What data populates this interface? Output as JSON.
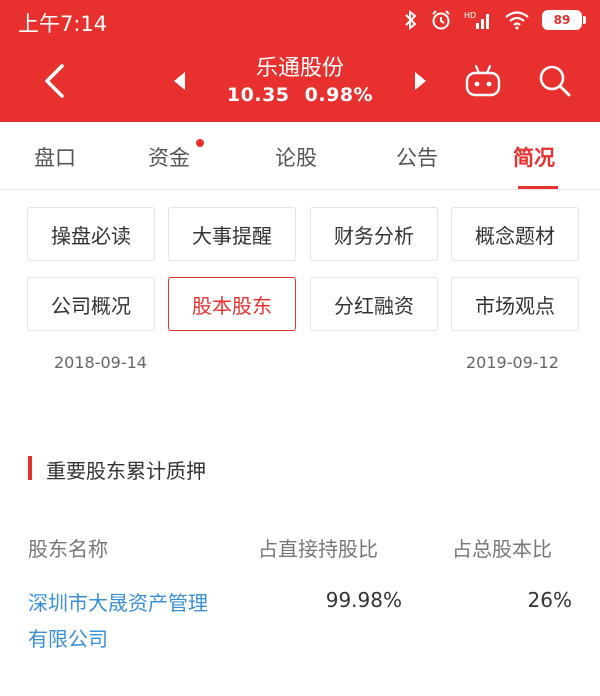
{
  "status_bar": {
    "time": "上午7:14",
    "battery": "89"
  },
  "header": {
    "stock_name": "乐通股份",
    "price": "10.35",
    "change_pct": "0.98%",
    "background_color": "#e8312f"
  },
  "tabs": [
    {
      "label": "盘口",
      "active": false,
      "dot": false
    },
    {
      "label": "资金",
      "active": false,
      "dot": true
    },
    {
      "label": "论股",
      "active": false,
      "dot": false
    },
    {
      "label": "公告",
      "active": false,
      "dot": false
    },
    {
      "label": "简况",
      "active": true,
      "dot": false
    }
  ],
  "grid_buttons": [
    {
      "label": "操盘必读",
      "active": false
    },
    {
      "label": "大事提醒",
      "active": false
    },
    {
      "label": "财务分析",
      "active": false
    },
    {
      "label": "概念题材",
      "active": false
    },
    {
      "label": "公司概况",
      "active": false
    },
    {
      "label": "股本股东",
      "active": true
    },
    {
      "label": "分红融资",
      "active": false
    },
    {
      "label": "市场观点",
      "active": false
    }
  ],
  "dates": {
    "start": "2018-09-14",
    "end": "2019-09-12"
  },
  "pledge_section": {
    "title": "重要股东累计质押",
    "columns": [
      "股东名称",
      "占直接持股比",
      "占总股本比"
    ],
    "rows": [
      {
        "name": "深圳市大晟资产管理有限公司",
        "direct_ratio": "99.98%",
        "total_ratio": "26%"
      }
    ]
  },
  "colors": {
    "accent": "#e8312f",
    "link": "#3a8fd9"
  },
  "icons": {
    "bluetooth": "bluetooth-icon",
    "alarm": "alarm-icon",
    "signal": "signal-icon",
    "wifi": "wifi-icon",
    "back": "chevron-left-icon",
    "prev": "triangle-left-icon",
    "next": "triangle-right-icon",
    "robot": "robot-icon",
    "search": "search-icon"
  }
}
